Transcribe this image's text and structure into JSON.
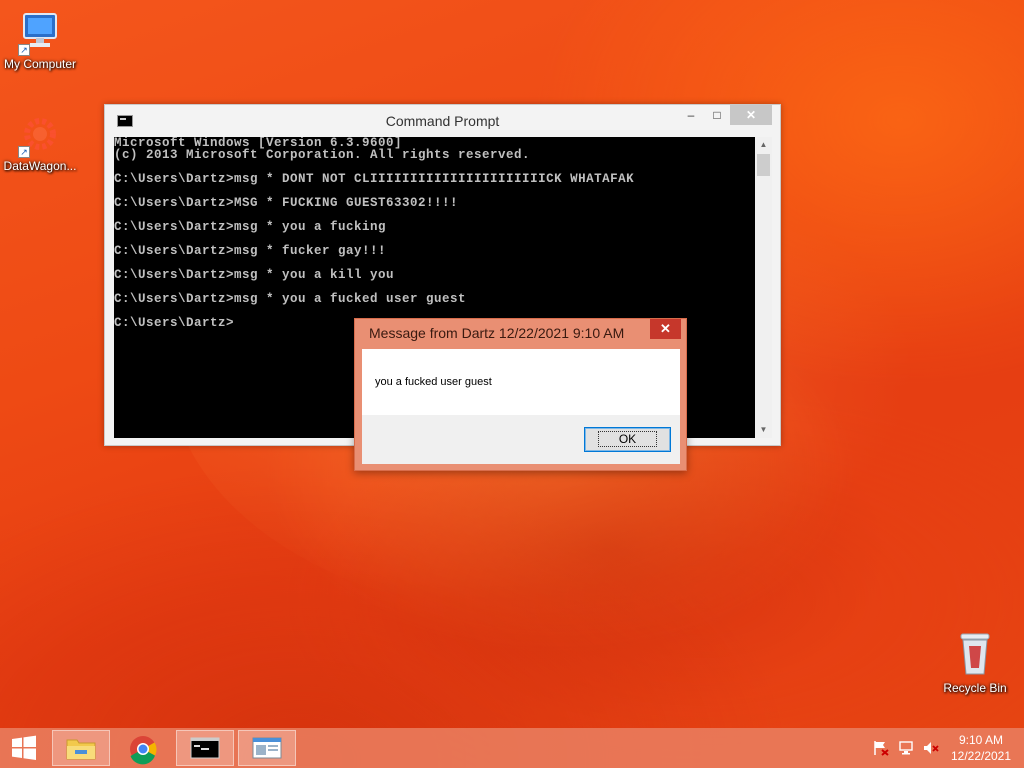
{
  "desktop": {
    "icons": [
      {
        "label": "My Computer",
        "icon": "computer-icon"
      },
      {
        "label": "DataWagon...",
        "icon": "gear-icon"
      },
      {
        "label": "Recycle Bin",
        "icon": "recycle-bin-icon"
      }
    ]
  },
  "cmd_window": {
    "title": "Command Prompt",
    "icon": "cmd-icon",
    "controls": {
      "minimize": "–",
      "maximize": "□",
      "close": "✕"
    },
    "lines": [
      "Microsoft Windows [Version 6.3.9600]",
      "(c) 2013 Microsoft Corporation. All rights reserved.",
      "",
      "C:\\Users\\Dartz>msg * DONT NOT CLIIIIIIIIIIIIIIIIIIIIIICK WHATAFAK",
      "",
      "C:\\Users\\Dartz>MSG * FUCKING GUEST63302!!!!",
      "",
      "C:\\Users\\Dartz>msg * you a fucking",
      "",
      "C:\\Users\\Dartz>msg * fucker gay!!!",
      "",
      "C:\\Users\\Dartz>msg * you a kill you",
      "",
      "C:\\Users\\Dartz>msg * you a fucked user guest",
      "",
      "C:\\Users\\Dartz>"
    ]
  },
  "message_box": {
    "title": "Message from Dartz 12/22/2021 9:10 AM",
    "close": "✕",
    "text": "you a fucked user guest",
    "ok_label": "OK"
  },
  "taskbar": {
    "items": [
      {
        "name": "start-button",
        "icon": "windows-logo-icon"
      },
      {
        "name": "file-explorer",
        "icon": "folder-icon"
      },
      {
        "name": "chrome",
        "icon": "chrome-icon"
      },
      {
        "name": "command-prompt",
        "icon": "cmd-icon"
      },
      {
        "name": "message-window",
        "icon": "window-icon"
      }
    ],
    "tray": {
      "icons": [
        "flag-icon",
        "network-icon",
        "volume-muted-icon"
      ],
      "time": "9:10 AM",
      "date": "12/22/2021"
    }
  },
  "colors": {
    "accent": "#e97d5f",
    "message_border": "#e98f73",
    "close_red": "#c6372b",
    "terminal_bg": "#000000",
    "terminal_fg": "#c0c0c0"
  }
}
